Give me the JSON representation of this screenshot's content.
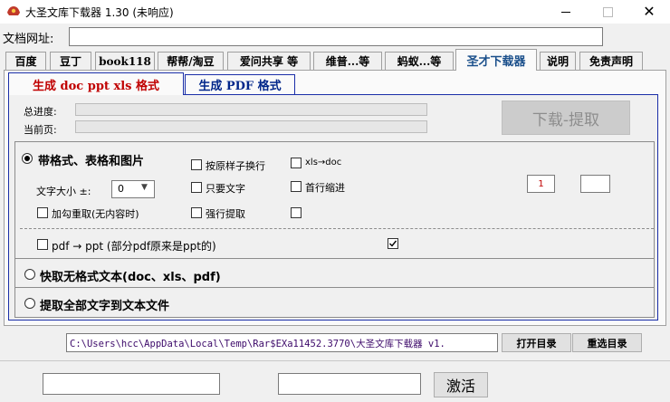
{
  "window": {
    "title": "大圣文库下载器 1.30 (未响应)",
    "close_glyph": "✕"
  },
  "url_bar": {
    "label": "文档网址:",
    "value": ""
  },
  "tabs": [
    {
      "label": "百度"
    },
    {
      "label": "豆丁"
    },
    {
      "label": "book118"
    },
    {
      "label": "帮帮/淘豆"
    },
    {
      "label": "爱问共享 等"
    },
    {
      "label": "维普...等"
    },
    {
      "label": "蚂蚁...等"
    },
    {
      "label": "圣才下载器"
    },
    {
      "label": "说明"
    },
    {
      "label": "免责声明"
    }
  ],
  "subtabs": {
    "active": "生成 doc ppt xls 格式",
    "inactive": "生成 PDF 格式"
  },
  "progress": {
    "total_label": "总进度:",
    "total_value": 0,
    "current_label": "当前页:",
    "current_value": 0
  },
  "download_button": "下载-提取",
  "options": {
    "radio1": "带格式、表格和图片",
    "keep_line_breaks": {
      "label": "按原样子换行",
      "checked": false
    },
    "xls_to_doc": {
      "label": "xls→doc",
      "checked": false
    },
    "font_size_label": "文字大小 ±:",
    "font_size_value": "0",
    "text_only": {
      "label": "只要文字",
      "checked": false
    },
    "first_line_indent": {
      "label": "首行缩进",
      "checked": false
    },
    "bold_redo": {
      "label": "加勾重取(无内容时)",
      "checked": false
    },
    "force_extract": {
      "label": "强行提取",
      "checked": false
    },
    "unlabeled_check": {
      "checked": false
    },
    "num_box1": "1",
    "num_box2": "",
    "pdf_to_ppt": {
      "label": "pdf → ppt (部分pdf原来是ppt的)",
      "checked": false
    },
    "pdf_to_ppt_right": {
      "checked": true
    },
    "radio2": "快取无格式文本(doc、xls、pdf)",
    "radio3": "提取全部文字到文本文件"
  },
  "path": {
    "value": "C:\\Users\\hcc\\AppData\\Local\\Temp\\Rar$EXa11452.3770\\大圣文库下载器 v1.",
    "open_dir": "打开目录",
    "reselect_dir": "重选目录"
  },
  "bottom": {
    "input1": "",
    "input2": "",
    "activate": "激活"
  }
}
